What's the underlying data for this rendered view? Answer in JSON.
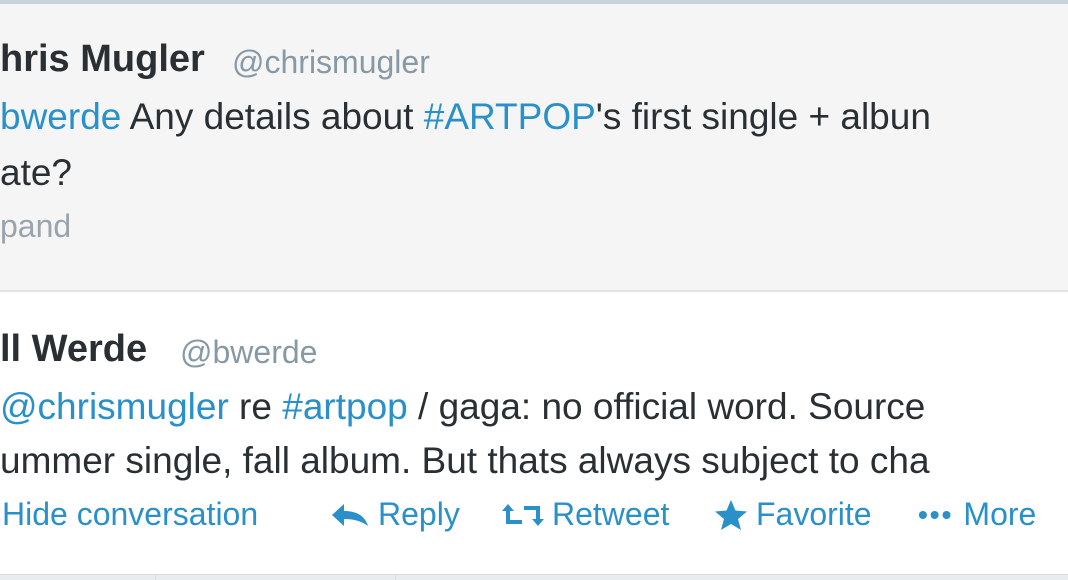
{
  "tweet1": {
    "name": "hris Mugler",
    "handle": "@chrismugler",
    "mention": "bwerde",
    "text_a": " Any details about ",
    "hashtag": "#ARTPOP",
    "text_b": "'s first single + albun",
    "line2": "ate?",
    "expand": "pand"
  },
  "tweet2": {
    "name": "ll Werde",
    "handle": "@bwerde",
    "mention": "@chrismugler",
    "text_a": " re ",
    "hashtag": "#artpop",
    "text_b": " / gaga: no official word. Source",
    "line2": "ummer single, fall album. But thats always subject to cha",
    "actions": {
      "hide_conversation": "Hide conversation",
      "reply": "Reply",
      "retweet": "Retweet",
      "favorite": "Favorite",
      "more_dots": "•••",
      "more": "More"
    }
  },
  "colors": {
    "link": "#2a90c9",
    "name": "#292f33",
    "handle": "#8899a6",
    "tweet1_bg": "#f5f5f5"
  },
  "icons": [
    "reply-icon",
    "retweet-icon",
    "star-icon",
    "more-dots-icon"
  ]
}
